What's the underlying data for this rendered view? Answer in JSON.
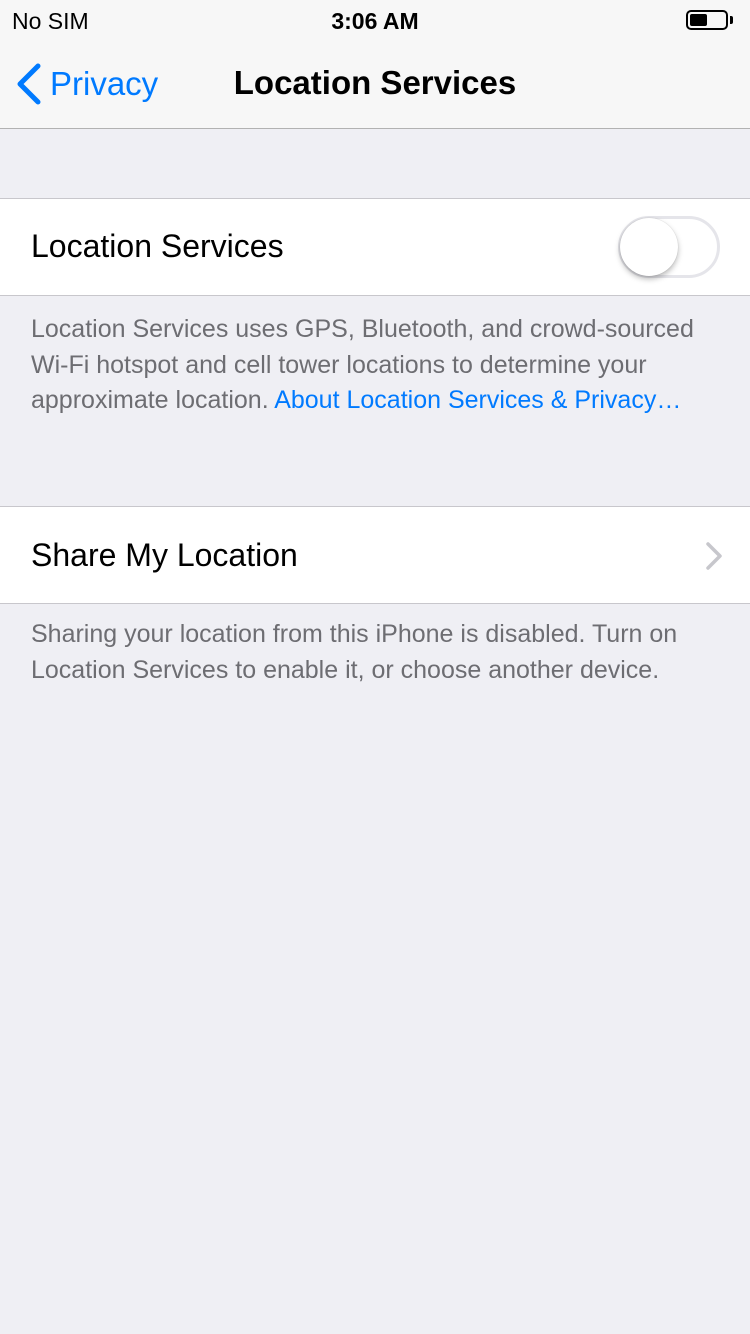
{
  "status_bar": {
    "carrier": "No SIM",
    "time": "3:06 AM",
    "battery_level": 0.5
  },
  "nav": {
    "back_label": "Privacy",
    "title": "Location Services"
  },
  "location_services": {
    "label": "Location Services",
    "toggle_on": false,
    "footer_text": "Location Services uses GPS, Bluetooth, and crowd-sourced Wi-Fi hotspot and cell tower locations to determine your approximate location. ",
    "footer_link": "About Location Services & Privacy…"
  },
  "share_my_location": {
    "label": "Share My Location",
    "footer_text": "Sharing your location from this iPhone is disabled. Turn on Location Services to enable it, or choose another device."
  },
  "colors": {
    "accent": "#007aff",
    "background": "#efeff4",
    "footer_text": "#6d6d72"
  }
}
